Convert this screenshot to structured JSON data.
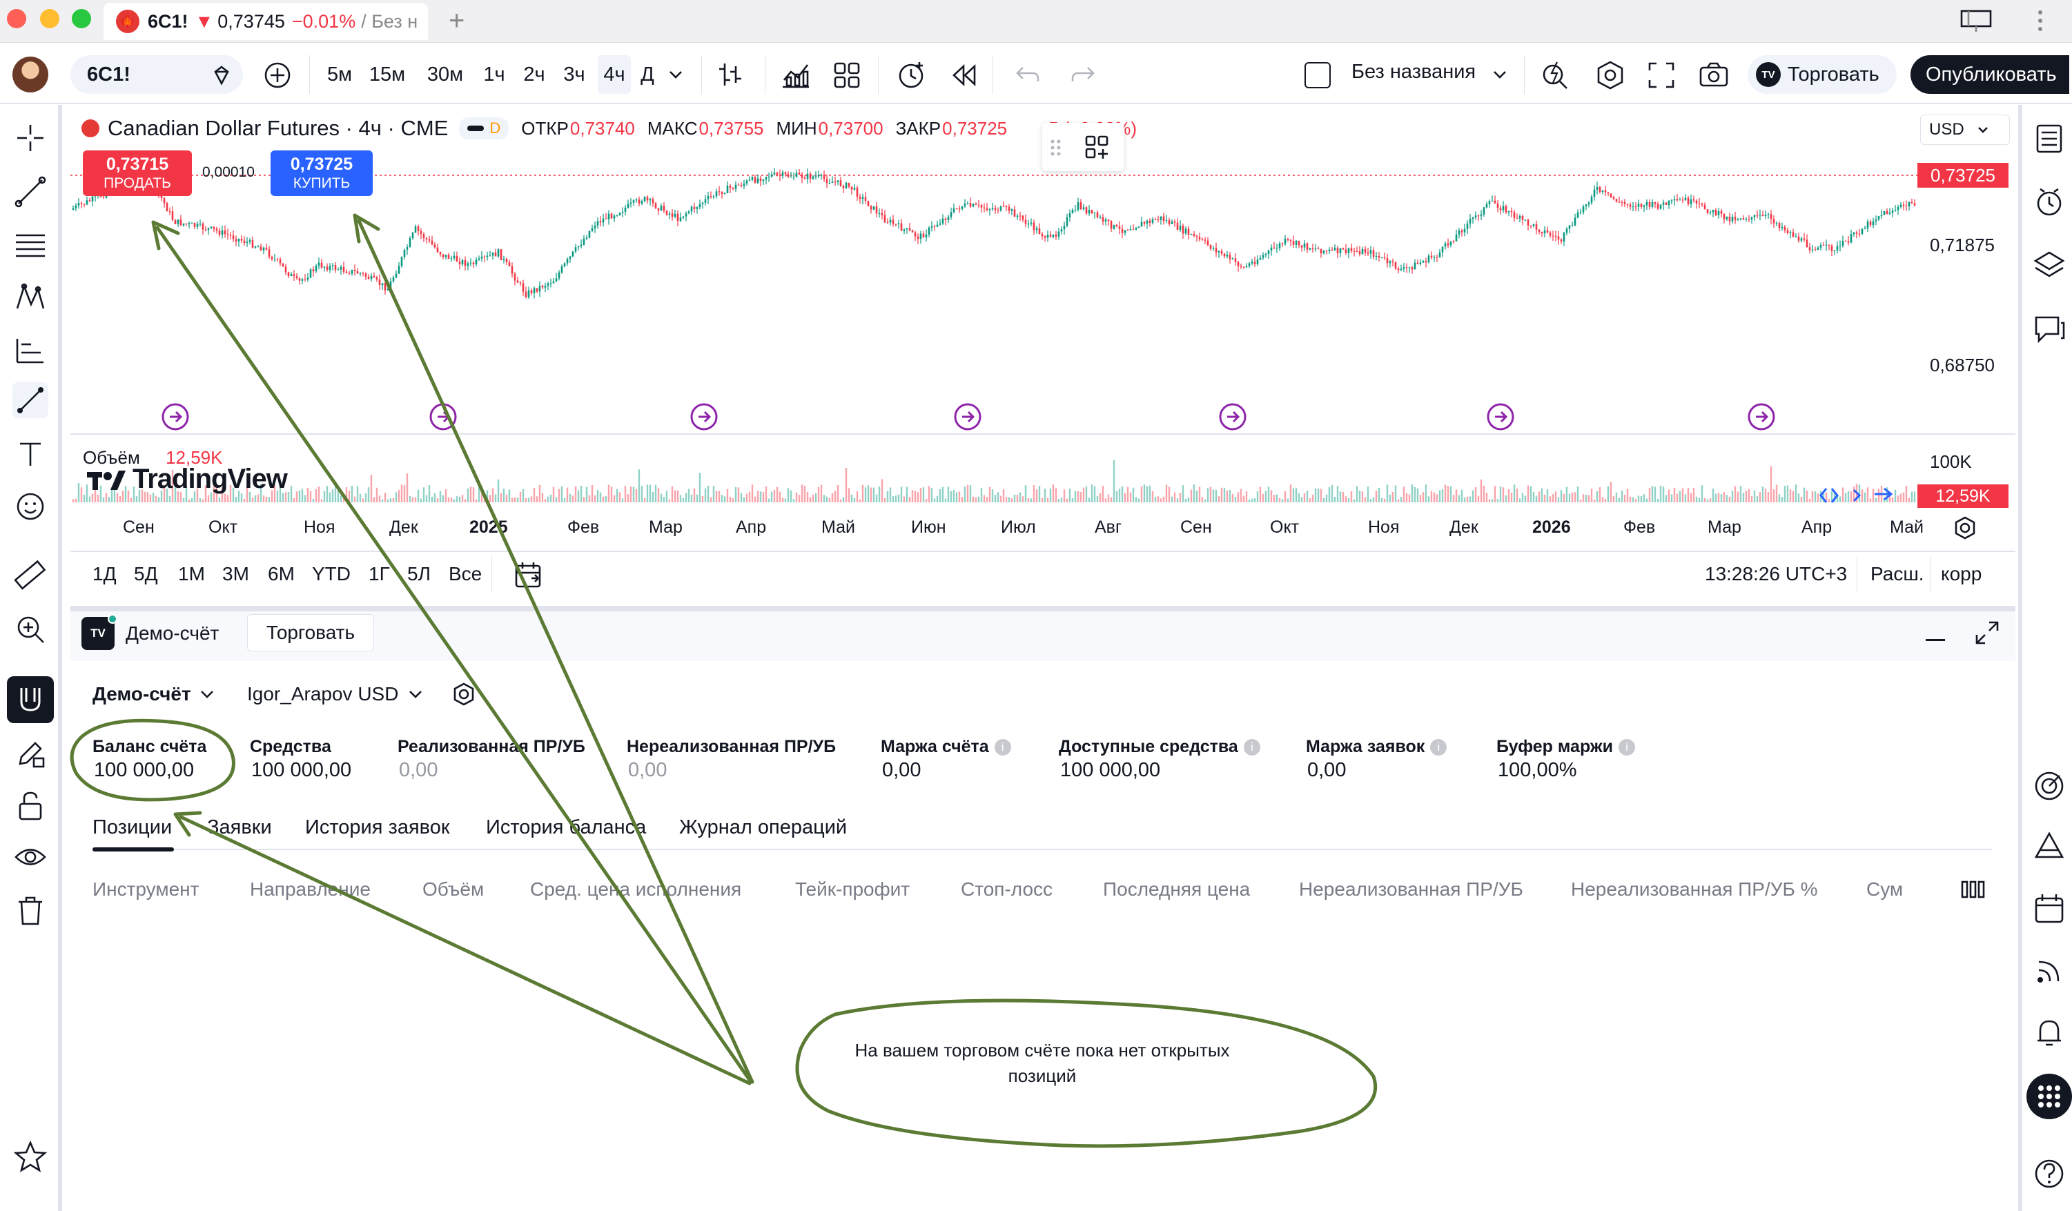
{
  "window": {
    "tab_title": "6C1! ▼ 0,73745 −0.01% / Без н",
    "tab_symbol": "6C1!",
    "tab_arrow": "▼",
    "tab_price": "0,73745",
    "tab_change": "−0.01%",
    "tab_suffix": "/ Без н"
  },
  "toolbar": {
    "symbol": "6C1!",
    "intervals": [
      "5м",
      "15м",
      "30м",
      "1ч",
      "2ч",
      "3ч",
      "4ч",
      "Д"
    ],
    "active_interval": "4ч",
    "layout_name": "Без названия",
    "trade_button": "Торговать",
    "publish_button": "Опубликовать"
  },
  "chart": {
    "instrument": "Canadian Dollar Futures · 4ч · CME",
    "badge": "D",
    "open_label": "ОТКР",
    "open": "0,73740",
    "high_label": "МАКС",
    "high": "0,73755",
    "low_label": "МИН",
    "low": "0,73700",
    "close_label": "ЗАКР",
    "close": "0,73725",
    "change": "5 (−0,02%)",
    "sell_price": "0,73715",
    "sell_label": "ПРОДАТЬ",
    "buy_price": "0,73725",
    "buy_label": "КУПИТЬ",
    "spread": "0,00010",
    "currency": "USD",
    "last_price_tag": "0,73725",
    "price_levels": [
      "0,71875",
      "0,68750"
    ],
    "volume_label": "Объём",
    "volume_value": "12,59K",
    "volume_scale": "100K",
    "volume_tag": "12,59K",
    "logo_text": "TradingView",
    "time_labels": [
      "Сен",
      "Окт",
      "Ноя",
      "Дек",
      "2025",
      "Фев",
      "Мар",
      "Апр",
      "Май",
      "Июн",
      "Июл",
      "Авг",
      "Сен",
      "Окт",
      "Ноя",
      "Дек",
      "2026",
      "Фев",
      "Мар",
      "Апр",
      "Май"
    ],
    "colors": {
      "up": "#089981",
      "down": "#f23645",
      "accent": "#2962ff",
      "annotation": "#5b7a33"
    }
  },
  "range_bar": {
    "ranges": [
      "1Д",
      "5Д",
      "1М",
      "3М",
      "6М",
      "YTD",
      "1Г",
      "5Л",
      "Все"
    ],
    "clock": "13:28:26 UTC+3",
    "session": "Расш.",
    "adjust": "корр"
  },
  "account_panel": {
    "broker": "Демо-счёт",
    "trade_button": "Торговать",
    "account_selector": "Демо-счёт",
    "user_selector": "Igor_Arapov USD",
    "stats": [
      {
        "label": "Баланс счёта",
        "value": "100 000,00"
      },
      {
        "label": "Средства",
        "value": "100 000,00"
      },
      {
        "label": "Реализованная ПР/УБ",
        "value": "0,00"
      },
      {
        "label": "Нереализованная ПР/УБ",
        "value": "0,00"
      },
      {
        "label": "Маржа счёта",
        "value": "0,00"
      },
      {
        "label": "Доступные средства",
        "value": "100 000,00"
      },
      {
        "label": "Маржа заявок",
        "value": "0,00"
      },
      {
        "label": "Буфер маржи",
        "value": "100,00%"
      }
    ],
    "tabs": [
      "Позиции",
      "Заявки",
      "История заявок",
      "История баланса",
      "Журнал операций"
    ],
    "active_tab": "Позиции",
    "columns": [
      "Инструмент",
      "Направление",
      "Объём",
      "Сред. цена исполнения",
      "Тейк-профит",
      "Стоп-лосс",
      "Последняя цена",
      "Нереализованная ПР/УБ",
      "Нереализованная ПР/УБ %",
      "Сум"
    ],
    "empty_message_line1": "На вашем торговом счёте пока нет открытых",
    "empty_message_line2": "позиций"
  }
}
